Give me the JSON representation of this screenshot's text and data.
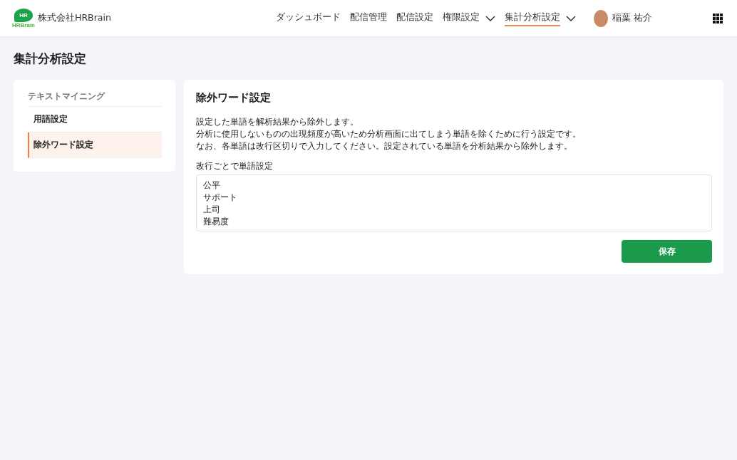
{
  "header": {
    "logo": {
      "mark": "HR",
      "wordmark": "HRBrain"
    },
    "company": "株式会社HRBrain",
    "nav": [
      {
        "label": "ダッシュボード",
        "dropdown": false,
        "selected": false
      },
      {
        "label": "配信管理",
        "dropdown": false,
        "selected": false
      },
      {
        "label": "配信設定",
        "dropdown": false,
        "selected": false
      },
      {
        "label": "権限設定",
        "dropdown": true,
        "selected": false
      },
      {
        "label": "集計分析設定",
        "dropdown": true,
        "selected": true
      }
    ],
    "user": {
      "name": "稲葉 祐介"
    }
  },
  "page_title": "集計分析設定",
  "sidebar": {
    "section": "テキストマイニング",
    "items": [
      {
        "label": "用語設定",
        "selected": false
      },
      {
        "label": "除外ワード設定",
        "selected": true
      }
    ]
  },
  "panel": {
    "title": "除外ワード設定",
    "description": [
      "設定した単語を解析結果から除外します。",
      "分析に使用しないものの出現頻度が高いため分析画面に出てしまう単語を除くために行う設定です。",
      "なお、各単語は改行区切りで入力してください。設定されている単語を分析結果から除外します。"
    ],
    "field": {
      "label": "改行ごとで単語設定",
      "lines": [
        "公平",
        "サポート",
        "上司",
        "難易度"
      ]
    },
    "save_button": "保存"
  }
}
